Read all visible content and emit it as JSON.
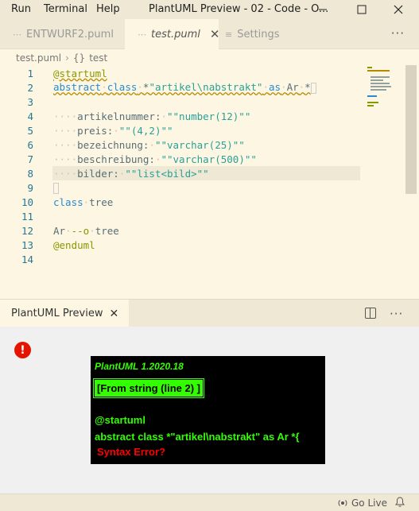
{
  "menu": {
    "run": "Run",
    "terminal": "Terminal",
    "help": "Help"
  },
  "window": {
    "title": "PlantUML Preview - 02 - Code - O..."
  },
  "tabs": [
    {
      "label": "ENTWURF2.puml"
    },
    {
      "label": "test.puml"
    },
    {
      "label": "Settings"
    }
  ],
  "breadcrumb": {
    "file": "test.puml",
    "symbol": "test"
  },
  "editor": {
    "lines": [
      {
        "n": "1"
      },
      {
        "n": "2"
      },
      {
        "n": "3"
      },
      {
        "n": "4"
      },
      {
        "n": "5"
      },
      {
        "n": "6"
      },
      {
        "n": "7"
      },
      {
        "n": "8"
      },
      {
        "n": "9"
      },
      {
        "n": "10"
      },
      {
        "n": "11"
      },
      {
        "n": "12"
      },
      {
        "n": "13"
      },
      {
        "n": "14"
      }
    ],
    "code": {
      "l1": "@startuml",
      "l2_kw": "abstract",
      "l2_kw2": "class",
      "l2_star": "*",
      "l2_str": "\"artikel\\nabstrakt\"",
      "l2_as": "as",
      "l2_id": "Ar",
      "l2_star2": "*",
      "l4_name": "artikelnummer:",
      "l4_str": "\"\"number(12)\"\"",
      "l5_name": "preis:",
      "l5_str": "\"\"(4,2)\"\"",
      "l6_name": "bezeichnung:",
      "l6_str": "\"\"varchar(25)\"\"",
      "l7_name": "beschreibung:",
      "l7_str": "\"\"varchar(500)\"\"",
      "l8_name": "bilder:",
      "l8_str": "\"\"list<bild>\"\"",
      "l10_kw": "class",
      "l10_id": "tree",
      "l12_a": "Ar",
      "l12_arrow": "--o",
      "l12_b": "tree",
      "l13": "@enduml"
    }
  },
  "panel": {
    "tab_label": "PlantUML Preview"
  },
  "preview": {
    "error_icon": "!",
    "version": "PlantUML 1.2020.18",
    "from_string": "[From string (line 2) ]",
    "line1": "@startuml",
    "line2": "abstract class *\"artikel\\nabstrakt\" as Ar *{",
    "error": "Syntax Error?"
  },
  "status": {
    "golive": "Go Live"
  },
  "colors": {
    "error_red": "#e51400",
    "diagram_green": "#33ff02",
    "editor_bg": "#fdf6e3"
  }
}
